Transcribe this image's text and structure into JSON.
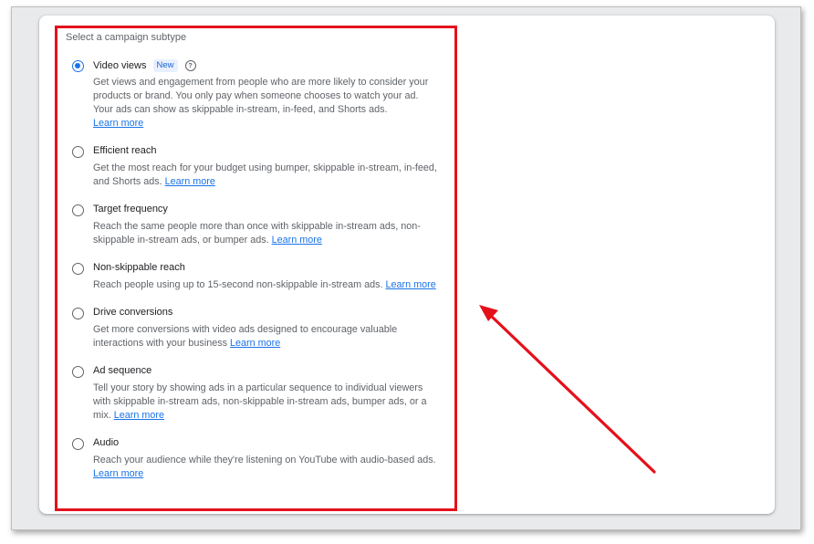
{
  "section": {
    "title": "Select a campaign subtype"
  },
  "options": [
    {
      "label": "Video views",
      "badge": "New",
      "selected": true,
      "description": "Get views and engagement from people who are more likely to consider your products or brand. You only pay when someone chooses to watch your ad. Your ads can show as skippable in-stream, in-feed, and Shorts ads.",
      "link": "Learn more"
    },
    {
      "label": "Efficient reach",
      "selected": false,
      "description": "Get the most reach for your budget using bumper, skippable in-stream, in-feed, and Shorts ads.",
      "link": "Learn more"
    },
    {
      "label": "Target frequency",
      "selected": false,
      "description": "Reach the same people more than once with skippable in-stream ads, non-skippable in-stream ads, or bumper ads.",
      "link": "Learn more"
    },
    {
      "label": "Non-skippable reach",
      "selected": false,
      "description": "Reach people using up to 15-second non-skippable in-stream ads.",
      "link": "Learn more"
    },
    {
      "label": "Drive conversions",
      "selected": false,
      "description": "Get more conversions with video ads designed to encourage valuable interactions with your business",
      "link": "Learn more"
    },
    {
      "label": "Ad sequence",
      "selected": false,
      "description": "Tell your story by showing ads in a particular sequence to individual viewers with skippable in-stream ads, non-skippable in-stream ads, bumper ads, or a mix.",
      "link": "Learn more"
    },
    {
      "label": "Audio",
      "selected": false,
      "description": "Reach your audience while they're listening on YouTube with audio-based ads.",
      "link": "Learn more"
    }
  ],
  "colors": {
    "accent": "#1a73e8",
    "annotation": "#e4111b"
  },
  "icons": {
    "help": "question-circle-icon"
  }
}
